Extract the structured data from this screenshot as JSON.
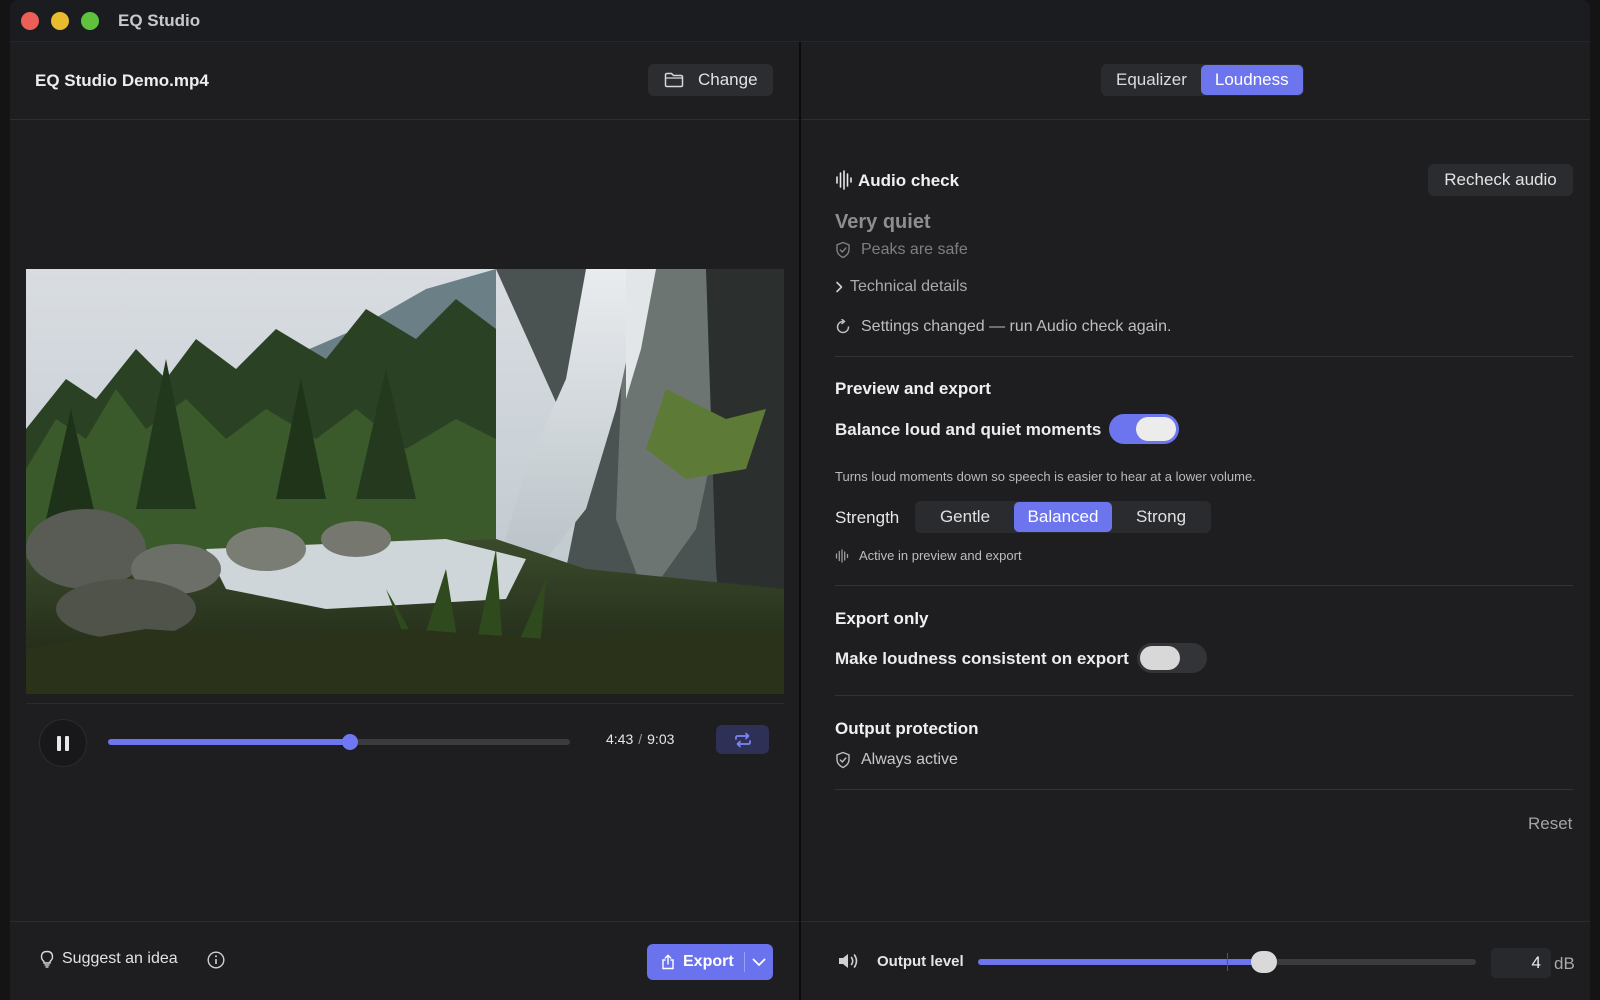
{
  "app": {
    "title": "EQ Studio"
  },
  "colors": {
    "accent": "#6c74ee",
    "background": "#1e1e20",
    "traffic_red": "#ec5f57",
    "traffic_yellow": "#e9bb2f",
    "traffic_green": "#5fc23f"
  },
  "left": {
    "file_name": "EQ Studio Demo.mp4",
    "change_label": "Change",
    "change_icon": "folder-icon",
    "video": {
      "description_icon": "waterfall-video-frame"
    },
    "player": {
      "play_state_icon": "pause-icon",
      "progress_fraction": 0.523,
      "current_time": "4:43",
      "separator": "/",
      "total_time": "9:03",
      "loop_icon": "repeat-icon"
    },
    "footer": {
      "suggest_label": "Suggest an idea",
      "suggest_icon": "lightbulb-icon",
      "info_icon": "info-icon",
      "export_label": "Export",
      "export_icon": "share-icon"
    }
  },
  "right": {
    "tabs": [
      {
        "label": "Equalizer",
        "active": false
      },
      {
        "label": "Loudness",
        "active": true
      }
    ],
    "audio_check": {
      "title": "Audio check",
      "recheck_label": "Recheck audio",
      "status": "Very quiet",
      "peaks": "Peaks are safe",
      "technical_details": "Technical details",
      "settings_changed": "Settings changed — run Audio check again."
    },
    "preview_export": {
      "title": "Preview and export",
      "balance_label": "Balance loud and quiet moments",
      "balance_on": true,
      "balance_desc": "Turns loud moments down so speech is easier to hear at a lower volume.",
      "strength_label": "Strength",
      "strength_options": [
        "Gentle",
        "Balanced",
        "Strong"
      ],
      "strength_selected": "Balanced",
      "active_note": "Active in preview and export"
    },
    "export_only": {
      "title": "Export only",
      "consistent_label": "Make loudness consistent on export",
      "consistent_on": false
    },
    "output_protection": {
      "title": "Output protection",
      "status": "Always active"
    },
    "reset_label": "Reset",
    "output_level": {
      "label": "Output level",
      "value": "4",
      "unit": "dB",
      "slider_fraction": 0.574
    }
  }
}
